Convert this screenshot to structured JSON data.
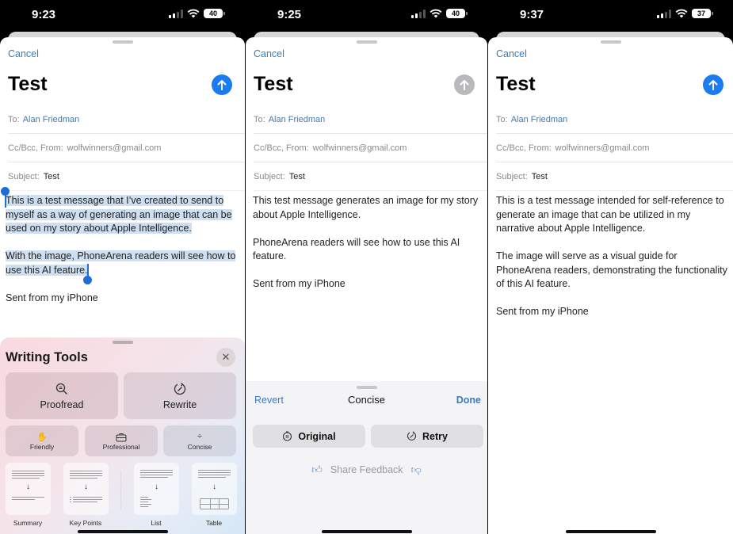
{
  "colors": {
    "accent_blue": "#3d7ab8",
    "send_blue": "#1a7cf0",
    "send_disabled": "#b9b9bc",
    "selection": "#cddff0"
  },
  "icons": {
    "send": "arrow-up-icon",
    "close": "close-icon",
    "proofread": "magnifier-icon",
    "rewrite": "rewrite-icon",
    "friendly": "hand-wave-icon",
    "professional": "briefcase-icon",
    "concise": "divide-icon",
    "thumbs_up": "thumbs-up-icon",
    "thumbs_down": "thumbs-down-icon"
  },
  "phones": [
    {
      "status": {
        "time": "9:23",
        "battery": "40"
      },
      "compose": {
        "cancel": "Cancel",
        "title": "Test",
        "to_label": "To:",
        "to_value": "Alan Friedman",
        "cc_label": "Cc/Bcc, From:",
        "cc_value": "wolfwinners@gmail.com",
        "subject_label": "Subject:",
        "subject_value": "Test",
        "body": [
          "This is a test message that I’ve created to send to myself as a way of generating an image that can be used on my story about Apple Intelligence.",
          "With the image, PhoneArena readers will see how to use this AI feature.",
          "Sent from my iPhone"
        ]
      },
      "writing_tools": {
        "title": "Writing Tools",
        "close": "✕",
        "proofread": "Proofread",
        "rewrite": "Rewrite",
        "friendly": "Friendly",
        "professional": "Professional",
        "concise": "Concise",
        "summary": "Summary",
        "key_points": "Key Points",
        "list": "List",
        "table": "Table"
      }
    },
    {
      "status": {
        "time": "9:25",
        "battery": "40"
      },
      "compose": {
        "cancel": "Cancel",
        "title": "Test",
        "to_label": "To:",
        "to_value": "Alan Friedman",
        "cc_label": "Cc/Bcc, From:",
        "cc_value": "wolfwinners@gmail.com",
        "subject_label": "Subject:",
        "subject_value": "Test",
        "body": [
          "This test message generates an image for my story about Apple Intelligence.",
          "PhoneArena readers will see how to use this AI feature.",
          "Sent from my iPhone"
        ]
      },
      "rewrite_sheet": {
        "revert": "Revert",
        "title": "Concise",
        "done": "Done",
        "original": "Original",
        "retry": "Retry",
        "feedback": "Share Feedback"
      }
    },
    {
      "status": {
        "time": "9:37",
        "battery": "37"
      },
      "compose": {
        "cancel": "Cancel",
        "title": "Test",
        "to_label": "To:",
        "to_value": "Alan Friedman",
        "cc_label": "Cc/Bcc, From:",
        "cc_value": "wolfwinners@gmail.com",
        "subject_label": "Subject:",
        "subject_value": "Test",
        "body": [
          "This is a test message intended for self-reference to generate an image that can be utilized in my narrative about Apple Intelligence.",
          "The image will serve as a visual guide for PhoneArena readers, demonstrating the functionality of this AI feature.",
          "Sent from my iPhone"
        ]
      }
    }
  ]
}
